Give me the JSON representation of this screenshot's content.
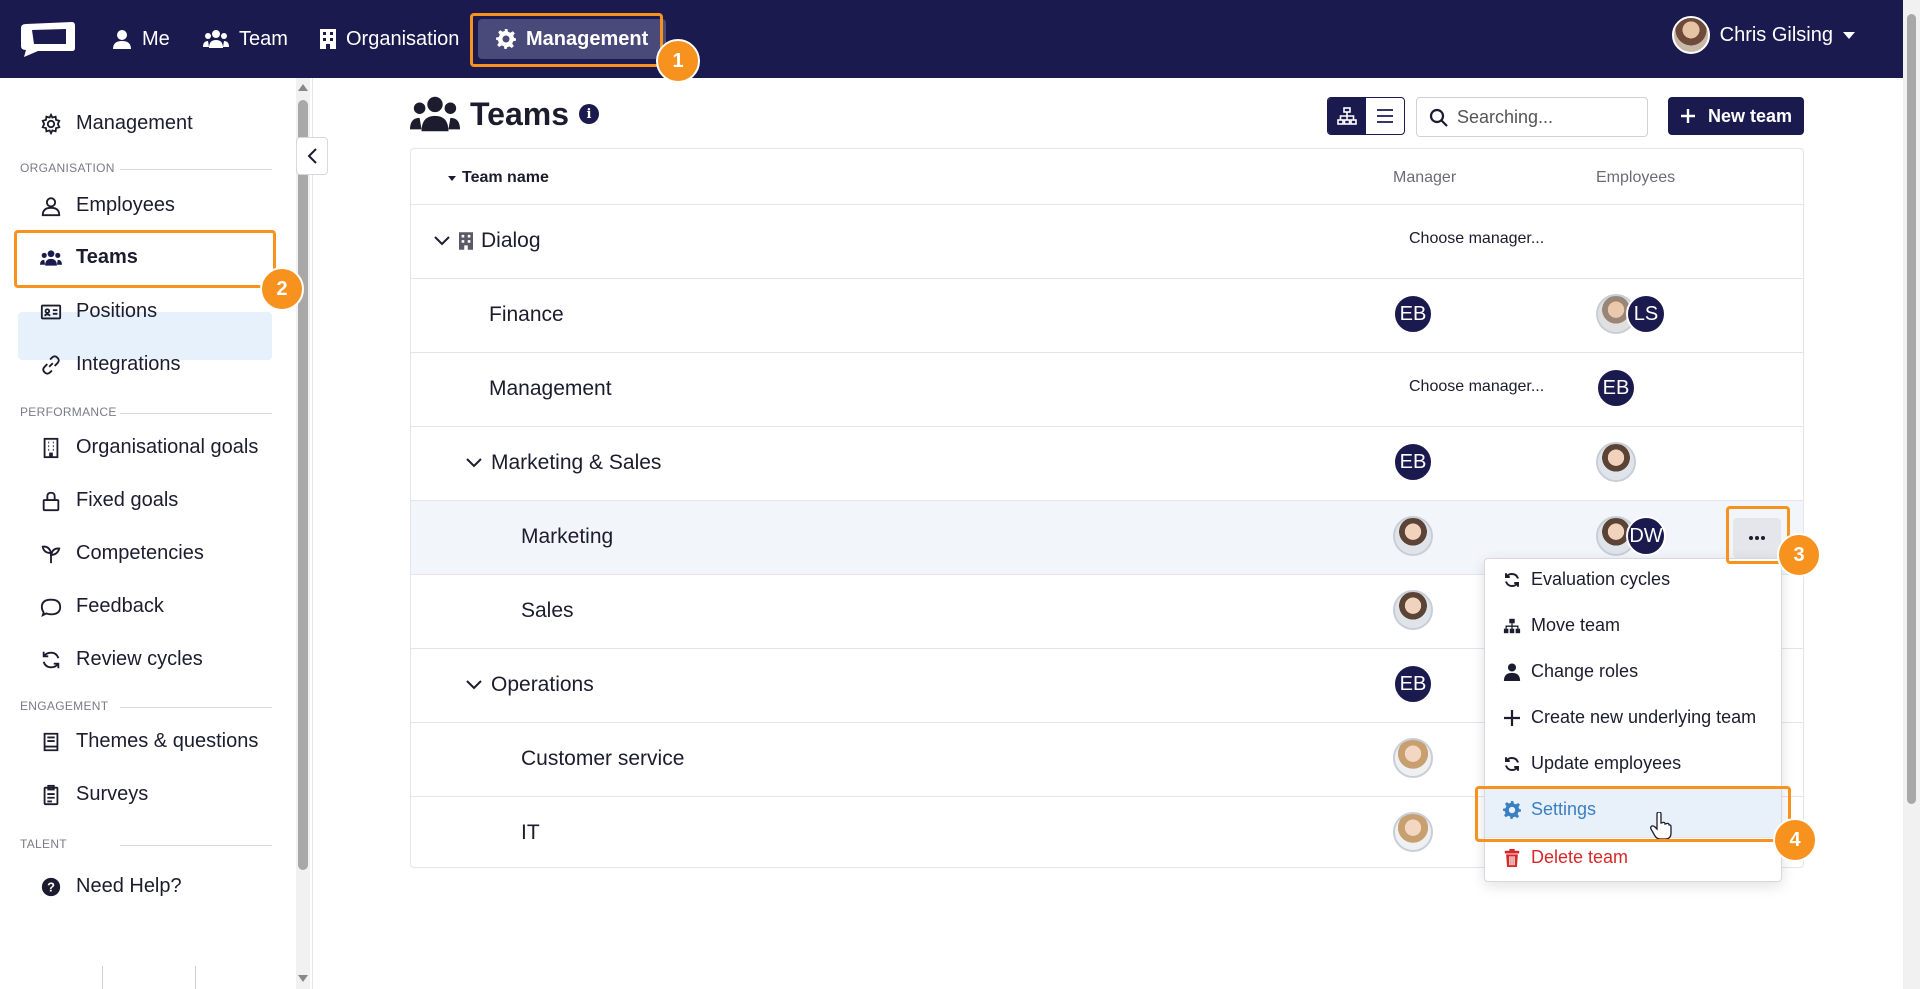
{
  "topnav": {
    "items": [
      {
        "label": "Me",
        "icon": "user-icon"
      },
      {
        "label": "Team",
        "icon": "users-icon"
      },
      {
        "label": "Organisation",
        "icon": "building-icon"
      },
      {
        "label": "Management",
        "icon": "gear-icon",
        "active": true
      }
    ],
    "user_name": "Chris Gilsing"
  },
  "sidebar": {
    "management": "Management",
    "sections": {
      "organisation": "ORGANISATION",
      "performance": "PERFORMANCE",
      "engagement": "ENGAGEMENT",
      "talent": "TALENT"
    },
    "items": {
      "employees": "Employees",
      "teams": "Teams",
      "positions": "Positions",
      "integrations": "Integrations",
      "organisational_goals": "Organisational goals",
      "fixed_goals": "Fixed goals",
      "competencies": "Competencies",
      "feedback": "Feedback",
      "review_cycles": "Review cycles",
      "themes_questions": "Themes & questions",
      "surveys": "Surveys",
      "need_help": "Need Help?"
    }
  },
  "page": {
    "title": "Teams",
    "info": "i",
    "search_placeholder": "Searching...",
    "new_team": "New team"
  },
  "table": {
    "headers": {
      "team_name": "Team name",
      "manager": "Manager",
      "employees": "Employees"
    },
    "choose_manager": "Choose manager...",
    "rows": [
      {
        "name": "Dialog",
        "manager": "",
        "employees": []
      },
      {
        "name": "Finance",
        "manager": "EB",
        "employees": [
          "photo",
          "LS"
        ]
      },
      {
        "name": "Management",
        "manager": "",
        "employees": [
          "EB"
        ]
      },
      {
        "name": "Marketing & Sales",
        "manager": "EB",
        "employees": [
          "photo"
        ]
      },
      {
        "name": "Marketing",
        "manager": "photo",
        "employees": [
          "photo",
          "DW"
        ]
      },
      {
        "name": "Sales",
        "manager": "photo",
        "employees": []
      },
      {
        "name": "Operations",
        "manager": "EB",
        "employees": []
      },
      {
        "name": "Customer service",
        "manager": "photo",
        "employees": []
      },
      {
        "name": "IT",
        "manager": "photo",
        "employees": []
      }
    ]
  },
  "menu": {
    "evaluation_cycles": "Evaluation cycles",
    "move_team": "Move team",
    "change_roles": "Change roles",
    "create_underlying": "Create new underlying team",
    "update_employees": "Update employees",
    "settings": "Settings",
    "delete_team": "Delete team"
  },
  "annotations": [
    "1",
    "2",
    "3",
    "4"
  ],
  "colors": {
    "brand": "#1b1a4e",
    "highlight": "#f7921e",
    "settings": "#3a7fc1",
    "danger": "#d62828"
  }
}
